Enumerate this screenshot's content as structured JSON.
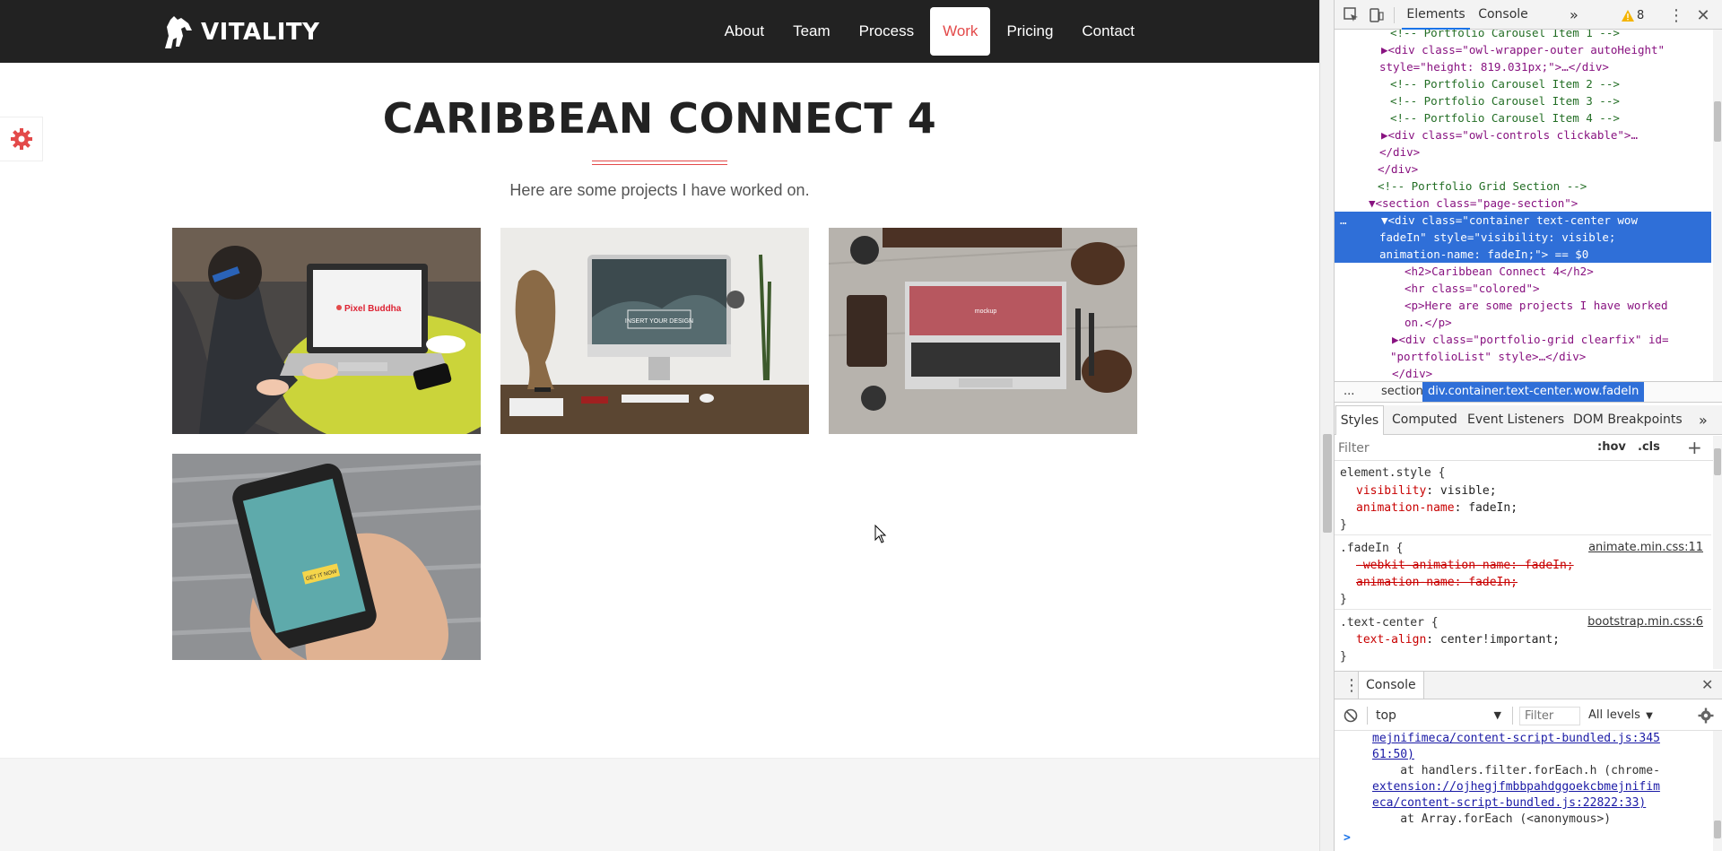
{
  "site": {
    "logo_text": "VITALITY",
    "nav": [
      "About",
      "Team",
      "Process",
      "Work",
      "Pricing",
      "Contact"
    ],
    "active_nav": "Work",
    "title": "CARIBBEAN CONNECT 4",
    "subtitle": "Here are some projects I have worked on.",
    "tiles": [
      {
        "icon": "laptop-photo",
        "screen_text": "Pixel Buddha"
      },
      {
        "icon": "imac-photo",
        "screen_text": "INSERT YOUR DESIGN"
      },
      {
        "icon": "macbook-desk-photo",
        "screen_text": "mockup"
      },
      {
        "icon": "phone-photo",
        "screen_text": "GET IT NOW"
      }
    ],
    "colors": {
      "accent": "#e34a4a",
      "navbar": "#222222"
    }
  },
  "devtools": {
    "tabs": [
      "Elements",
      "Console"
    ],
    "active_tab": "Elements",
    "warning_count": "8",
    "elements_lines": [
      {
        "text": "<!-- Portfolio Carousel Item 1 -->",
        "kind": "comment"
      },
      {
        "text": "▶<div class=\"owl-wrapper-outer autoHeight\"",
        "kind": "tag"
      },
      {
        "text": "style=\"height: 819.031px;\">…</div>",
        "kind": "tag"
      },
      {
        "text": "<!-- Portfolio Carousel Item 2 -->",
        "kind": "comment"
      },
      {
        "text": "<!-- Portfolio Carousel Item 3 -->",
        "kind": "comment"
      },
      {
        "text": "<!-- Portfolio Carousel Item 4 -->",
        "kind": "comment"
      },
      {
        "text": "▶<div class=\"owl-controls clickable\">…",
        "kind": "tag"
      },
      {
        "text": "</div>",
        "kind": "tag"
      },
      {
        "text": "</div>",
        "kind": "tag"
      },
      {
        "text": "<!-- Portfolio Grid Section -->",
        "kind": "comment"
      },
      {
        "text": "▼<section class=\"page-section\">",
        "kind": "tag"
      },
      {
        "text": "▼<div class=\"container text-center wow",
        "kind": "selected"
      },
      {
        "text": "fadeIn\" style=\"visibility: visible;",
        "kind": "selected"
      },
      {
        "text": "animation-name: fadeIn;\"> == $0",
        "kind": "selected"
      },
      {
        "text": "<h2>Caribbean Connect 4</h2>",
        "kind": "tag"
      },
      {
        "text": "<hr class=\"colored\">",
        "kind": "tag"
      },
      {
        "text": "<p>Here are some projects I have worked",
        "kind": "tag"
      },
      {
        "text": "on.</p>",
        "kind": "tag"
      },
      {
        "text": "▶<div class=\"portfolio-grid clearfix\" id=",
        "kind": "tag"
      },
      {
        "text": "\"portfolioList\" style>…</div>",
        "kind": "tag"
      },
      {
        "text": "</div>",
        "kind": "tag"
      }
    ],
    "breadcrumb": [
      "...",
      "section",
      "div.container.text-center.wow.fadeIn"
    ],
    "styles_tabs": [
      "Styles",
      "Computed",
      "Event Listeners",
      "DOM Breakpoints"
    ],
    "filter_placeholder": "Filter",
    "hov_label": ":hov",
    "cls_label": ".cls",
    "styles": {
      "element_style": "element.style {",
      "es_prop1": "visibility",
      "es_val1": ": visible;",
      "es_prop2": "animation-name",
      "es_val2": ": fadeIn;",
      "close": "}",
      "fadein_selector": ".fadeIn {",
      "fadein_src": "animate.min.css:11",
      "fadein_prop1": "-webkit-animation-name: fadeIn;",
      "fadein_prop2": "animation-name: fadeIn;",
      "tc_selector": ".text-center {",
      "tc_src": "bootstrap.min.css:6",
      "tc_prop": "text-align",
      "tc_val": ": center!important;"
    },
    "console": {
      "title": "Console",
      "context": "top",
      "filter_placeholder": "Filter",
      "levels": "All levels",
      "lines": [
        "mejnifimeca/content-script-bundled.js:345",
        "61:50)",
        "    at handlers.filter.forEach.h (chrome-",
        "extension://ojhegjfmbbpahdggoekcbmejnifim",
        "eca/content-script-bundled.js:22822:33)",
        "    at Array.forEach (<anonymous>)"
      ],
      "prompt": ">"
    }
  }
}
